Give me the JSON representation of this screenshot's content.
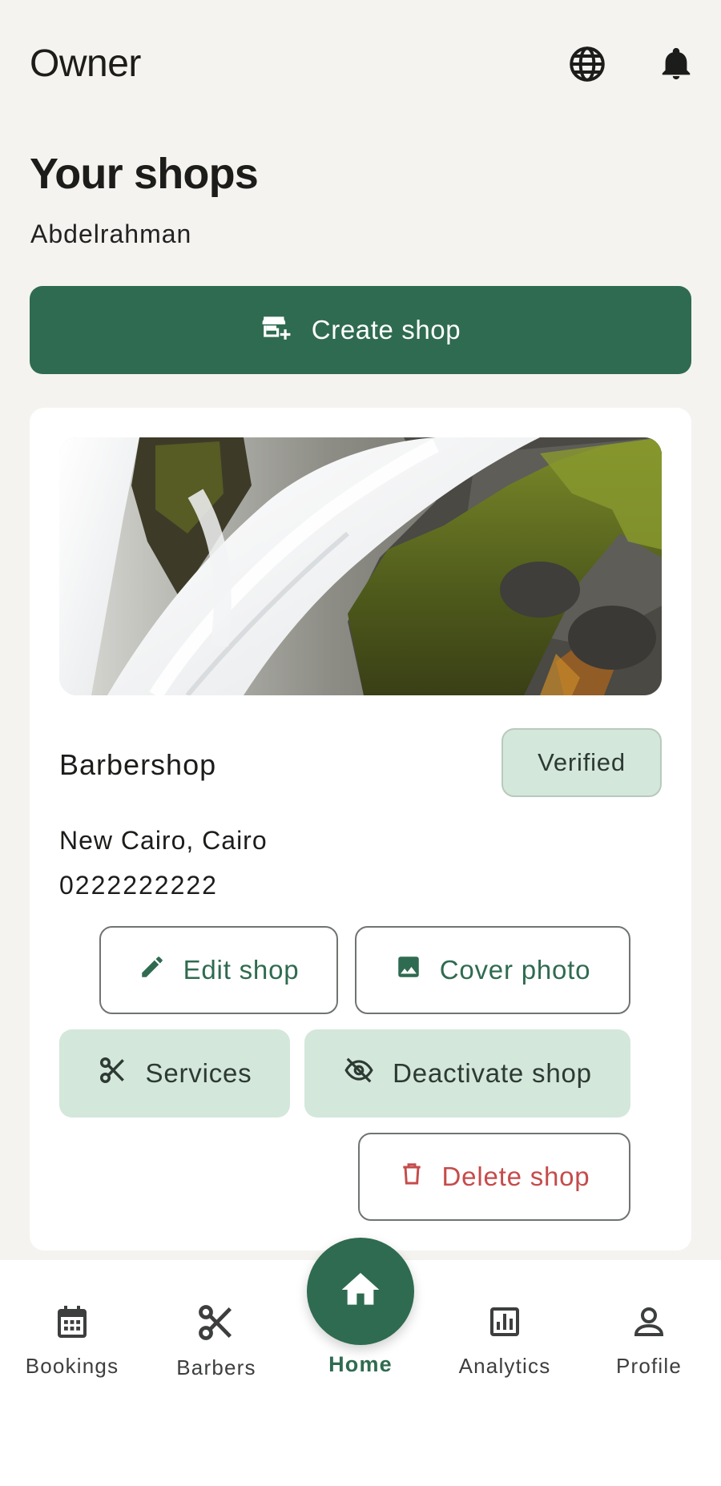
{
  "app_bar": {
    "title": "Owner",
    "icons": [
      "globe-icon",
      "bell-icon"
    ]
  },
  "header": {
    "heading": "Your shops",
    "owner_name": "Abdelrahman"
  },
  "create_button": {
    "label": "Create shop",
    "icon": "add-store-icon"
  },
  "shop_card": {
    "name": "Barbershop",
    "status": "Verified",
    "location": "New Cairo, Cairo",
    "phone": "0222222222",
    "actions": {
      "edit": "Edit shop",
      "cover": "Cover photo",
      "services": "Services",
      "deactivate": "Deactivate shop",
      "delete": "Delete shop"
    }
  },
  "bottom_nav": {
    "items": [
      "Bookings",
      "Barbers",
      "Home",
      "Analytics",
      "Profile"
    ],
    "active": "Home"
  },
  "colors": {
    "primary": "#2f6b50",
    "tonal": "#d3e7db",
    "danger": "#c64b4b",
    "background": "#f4f3ef"
  }
}
